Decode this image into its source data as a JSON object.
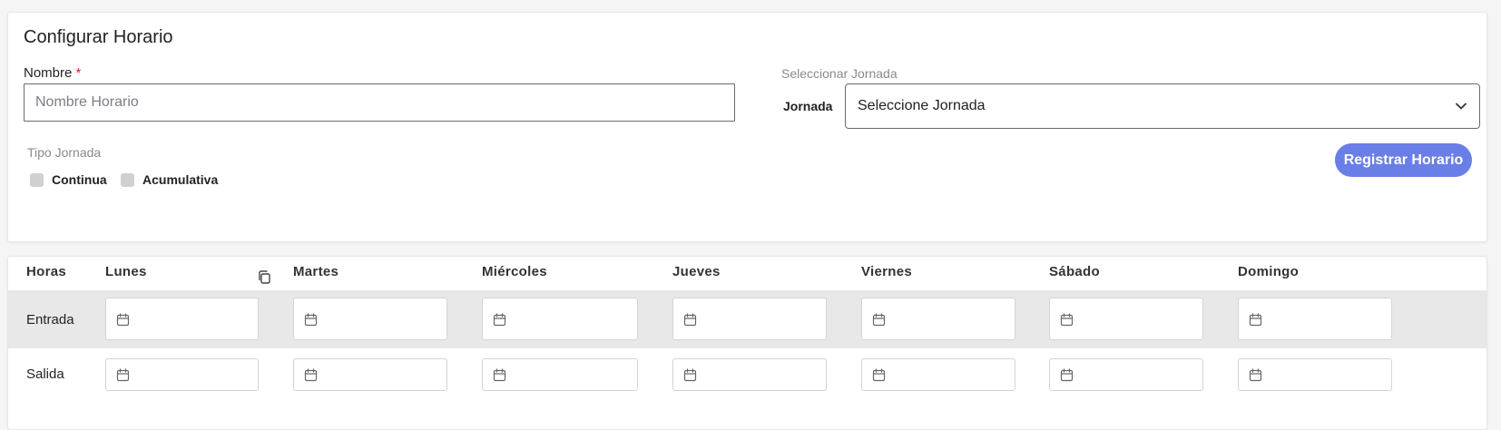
{
  "form": {
    "title": "Configurar Horario",
    "nombre_label": "Nombre",
    "required_mark": "*",
    "nombre_placeholder": "Nombre Horario",
    "nombre_value": "",
    "seleccionar_label": "Seleccionar Jornada",
    "jornada_label": "Jornada",
    "jornada_selected": "Seleccione Jornada",
    "tipo_label": "Tipo Jornada",
    "tipo_options": [
      {
        "label": "Continua",
        "checked": false
      },
      {
        "label": "Acumulativa",
        "checked": false
      }
    ],
    "register_button": "Registrar Horario",
    "accent_color": "#6a7ee8",
    "required_color": "#e0242a"
  },
  "schedule": {
    "headers": [
      "Horas",
      "Lunes",
      "Martes",
      "Miércoles",
      "Jueves",
      "Viernes",
      "Sábado",
      "Domingo"
    ],
    "rows": [
      {
        "label": "Entrada"
      },
      {
        "label": "Salida"
      }
    ],
    "icons": {
      "copy": "copy-icon",
      "input": "calendar-icon"
    }
  }
}
